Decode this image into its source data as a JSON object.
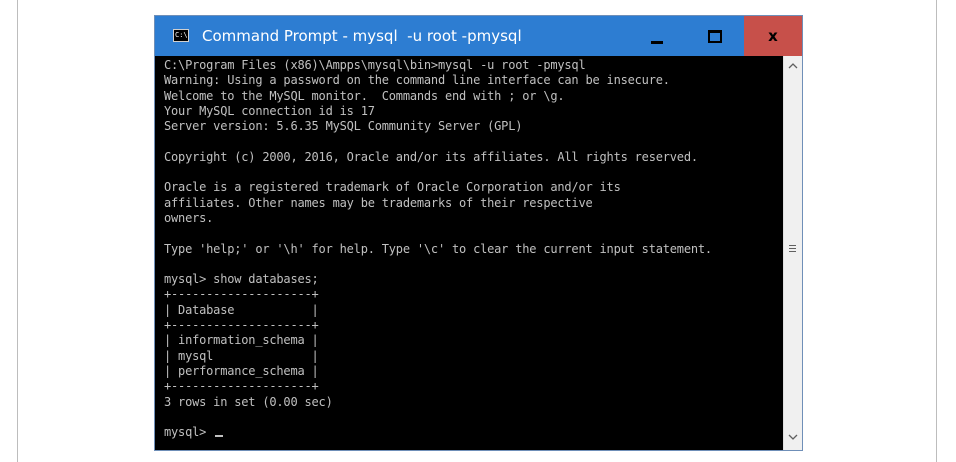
{
  "window": {
    "title": "Command Prompt - mysql  -u root -pmysql",
    "icon_label": "C:\\",
    "icon": "cmd-icon",
    "controls": {
      "minimize_icon": "minimize-icon",
      "maximize_icon": "maximize-icon",
      "close_icon": "close-icon",
      "close_glyph": "x"
    }
  },
  "colors": {
    "titlebar": "#2d7dd2",
    "close_button": "#c7504a",
    "console_background": "#000000",
    "console_text": "#c0c0c0"
  },
  "console": {
    "lines": [
      "C:\\Program Files (x86)\\Ampps\\mysql\\bin>mysql -u root -pmysql",
      "Warning: Using a password on the command line interface can be insecure.",
      "Welcome to the MySQL monitor.  Commands end with ; or \\g.",
      "Your MySQL connection id is 17",
      "Server version: 5.6.35 MySQL Community Server (GPL)",
      "",
      "Copyright (c) 2000, 2016, Oracle and/or its affiliates. All rights reserved.",
      "",
      "Oracle is a registered trademark of Oracle Corporation and/or its",
      "affiliates. Other names may be trademarks of their respective",
      "owners.",
      "",
      "Type 'help;' or '\\h' for help. Type '\\c' to clear the current input statement.",
      "",
      "mysql> show databases;",
      "+--------------------+",
      "| Database           |",
      "+--------------------+",
      "| information_schema |",
      "| mysql              |",
      "| performance_schema |",
      "+--------------------+",
      "3 rows in set (0.00 sec)",
      ""
    ],
    "prompt": "mysql> "
  },
  "scrollbar": {
    "up_icon": "scroll-up-icon",
    "down_icon": "scroll-down-icon",
    "thumb_icon": "scroll-grip-icon"
  }
}
